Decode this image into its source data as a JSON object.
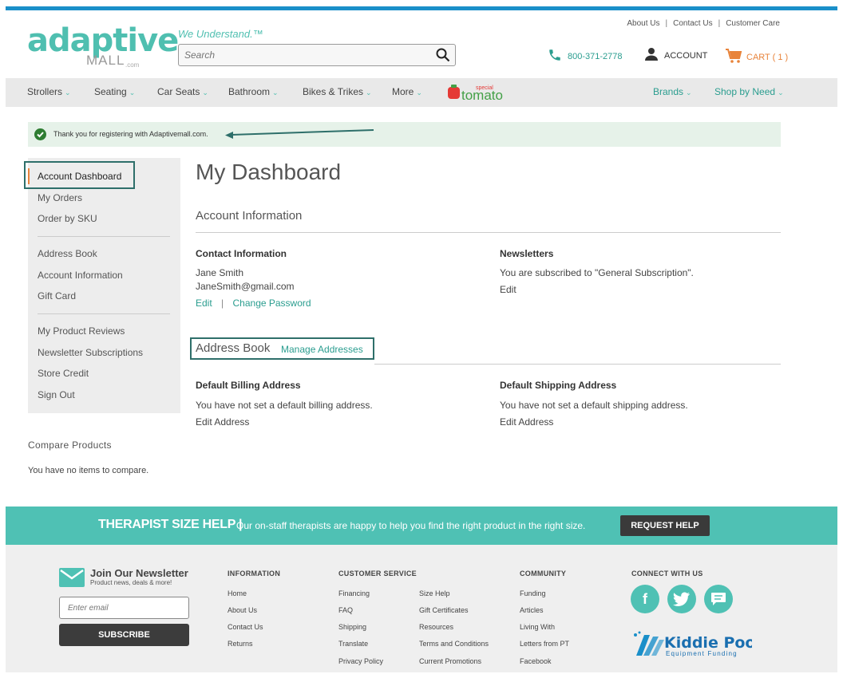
{
  "header": {
    "logo_main": "adaptive",
    "logo_sub": "MALL",
    "logo_com": ".com",
    "tagline": "We Understand.™",
    "search_placeholder": "Search",
    "top_links": [
      "About Us",
      "Contact Us",
      "Customer Care"
    ],
    "phone": "800-371-2778",
    "account_label": "ACCOUNT",
    "cart_label": "CART ( 1 )"
  },
  "nav": {
    "items": [
      "Strollers",
      "Seating",
      "Car Seats",
      "Bathroom",
      "Bikes & Trikes",
      "More"
    ],
    "brand_logo": "special tomato",
    "right_items": [
      "Brands",
      "Shop by Need"
    ]
  },
  "notice": {
    "message": "Thank you for registering with Adaptivemall.com."
  },
  "sidebar": {
    "group1": [
      "Account Dashboard",
      "My Orders",
      "Order by SKU"
    ],
    "group2": [
      "Address Book",
      "Account Information",
      "Gift Card"
    ],
    "group3": [
      "My Product Reviews",
      "Newsletter Subscriptions",
      "Store Credit",
      "Sign Out"
    ],
    "compare_title": "Compare Products",
    "compare_text": "You have no items to compare."
  },
  "dashboard": {
    "title": "My Dashboard",
    "account_info_title": "Account Information",
    "contact": {
      "heading": "Contact Information",
      "name": "Jane Smith",
      "email": "JaneSmith@gmail.com",
      "edit": "Edit",
      "sep": "|",
      "change_password": "Change Password"
    },
    "newsletters": {
      "heading": "Newsletters",
      "text": "You are subscribed to \"General Subscription\".",
      "edit": "Edit"
    },
    "address_book": {
      "title": "Address Book",
      "manage": "Manage Addresses",
      "billing_heading": "Default Billing Address",
      "billing_text": "You have not set a default billing address.",
      "billing_edit": "Edit Address",
      "shipping_heading": "Default Shipping Address",
      "shipping_text": "You have not set a default shipping address.",
      "shipping_edit": "Edit Address"
    }
  },
  "band": {
    "title": "THERAPIST SIZE HELP |",
    "text": "Our on-staff therapists are happy to help you find the right product in the right size.",
    "button": "REQUEST HELP"
  },
  "footer": {
    "newsletter_title": "Join Our Newsletter",
    "newsletter_sub": "Product news, deals & more!",
    "email_placeholder": "Enter email",
    "subscribe": "SUBSCRIBE",
    "information_title": "INFORMATION",
    "information": [
      "Home",
      "About Us",
      "Contact Us",
      "Returns"
    ],
    "customer_service_title": "CUSTOMER SERVICE",
    "customer_service_col1": [
      "Financing",
      "FAQ",
      "Shipping",
      "Translate",
      "Privacy Policy"
    ],
    "customer_service_col2": [
      "Size Help",
      "Gift Certificates",
      "Resources",
      "Terms and Conditions",
      "Current Promotions"
    ],
    "community_title": "COMMUNITY",
    "community": [
      "Funding",
      "Articles",
      "Living With",
      "Letters from PT",
      "Facebook"
    ],
    "connect_title": "CONNECT WITH US",
    "kiddie_title": "Kiddie Pool",
    "kiddie_sub": "Equipment Funding"
  },
  "colors": {
    "teal": "#4fc1b4",
    "link": "#2a9d8f",
    "orange": "#e8833a",
    "blue_bar": "#1a8fc9"
  }
}
